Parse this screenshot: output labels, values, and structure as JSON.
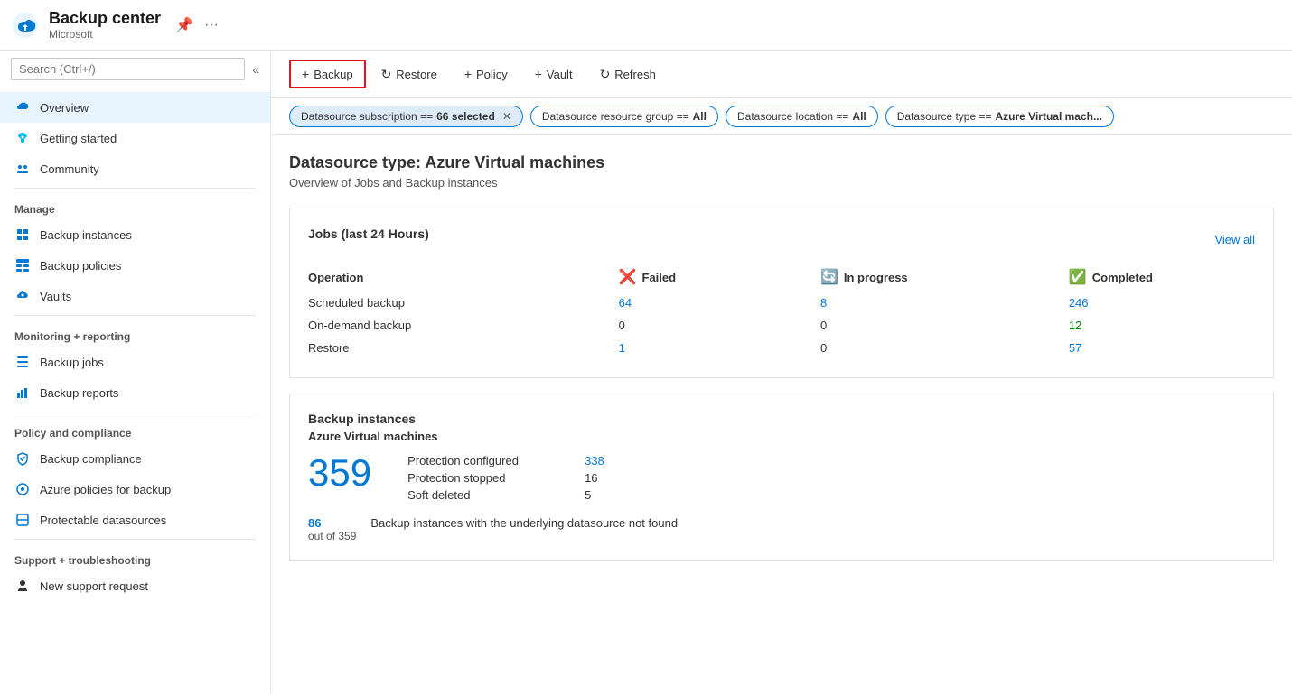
{
  "titleBar": {
    "title": "Backup center",
    "subtitle": "Microsoft"
  },
  "sidebar": {
    "search": {
      "placeholder": "Search (Ctrl+/)"
    },
    "navItems": [
      {
        "id": "overview",
        "label": "Overview",
        "active": true,
        "icon": "cloud"
      },
      {
        "id": "getting-started",
        "label": "Getting started",
        "active": false,
        "icon": "rocket"
      },
      {
        "id": "community",
        "label": "Community",
        "active": false,
        "icon": "users"
      },
      {
        "id": "manage-header",
        "label": "Manage",
        "type": "header"
      },
      {
        "id": "backup-instances",
        "label": "Backup instances",
        "active": false,
        "icon": "grid"
      },
      {
        "id": "backup-policies",
        "label": "Backup policies",
        "active": false,
        "icon": "table"
      },
      {
        "id": "vaults",
        "label": "Vaults",
        "active": false,
        "icon": "cloud-vault"
      },
      {
        "id": "monitoring-header",
        "label": "Monitoring + reporting",
        "type": "header"
      },
      {
        "id": "backup-jobs",
        "label": "Backup jobs",
        "active": false,
        "icon": "list"
      },
      {
        "id": "backup-reports",
        "label": "Backup reports",
        "active": false,
        "icon": "chart"
      },
      {
        "id": "policy-header",
        "label": "Policy and compliance",
        "type": "header"
      },
      {
        "id": "backup-compliance",
        "label": "Backup compliance",
        "active": false,
        "icon": "shield"
      },
      {
        "id": "azure-policies",
        "label": "Azure policies for backup",
        "active": false,
        "icon": "policy"
      },
      {
        "id": "protectable-datasources",
        "label": "Protectable datasources",
        "active": false,
        "icon": "datasource"
      },
      {
        "id": "support-header",
        "label": "Support + troubleshooting",
        "type": "header"
      },
      {
        "id": "new-support-request",
        "label": "New support request",
        "active": false,
        "icon": "person"
      }
    ]
  },
  "toolbar": {
    "buttons": [
      {
        "id": "backup",
        "label": "Backup",
        "icon": "+",
        "primary": true
      },
      {
        "id": "restore",
        "label": "Restore",
        "icon": "↻"
      },
      {
        "id": "policy",
        "label": "Policy",
        "icon": "+"
      },
      {
        "id": "vault",
        "label": "Vault",
        "icon": "+"
      },
      {
        "id": "refresh",
        "label": "Refresh",
        "icon": "↻"
      }
    ]
  },
  "filters": [
    {
      "id": "subscription",
      "label": "Datasource subscription == ",
      "bold": "66 selected",
      "active": true
    },
    {
      "id": "resource-group",
      "label": "Datasource resource group == ",
      "bold": "All",
      "active": false
    },
    {
      "id": "location",
      "label": "Datasource location == ",
      "bold": "All",
      "active": false
    },
    {
      "id": "datasource-type",
      "label": "Datasource type == ",
      "bold": "Azure Virtual mach...",
      "active": false
    }
  ],
  "page": {
    "title": "Datasource type: Azure Virtual machines",
    "subtitle": "Overview of Jobs and Backup instances"
  },
  "jobsCard": {
    "title": "Jobs (last 24 Hours)",
    "viewAll": "View all",
    "columns": {
      "operation": "Operation",
      "failed": "Failed",
      "inProgress": "In progress",
      "completed": "Completed"
    },
    "rows": [
      {
        "operation": "Scheduled backup",
        "failed": "64",
        "inProgress": "8",
        "completed": "246",
        "failedLink": true,
        "inProgressLink": true,
        "completedLink": true
      },
      {
        "operation": "On-demand backup",
        "failed": "0",
        "inProgress": "0",
        "completed": "12",
        "failedLink": false,
        "inProgressLink": false,
        "completedLink": true
      },
      {
        "operation": "Restore",
        "failed": "1",
        "inProgress": "0",
        "completed": "57",
        "failedLink": true,
        "inProgressLink": false,
        "completedLink": true
      }
    ]
  },
  "backupInstancesCard": {
    "sectionTitle": "Backup instances",
    "machineTitle": "Azure Virtual machines",
    "totalCount": "359",
    "details": [
      {
        "label": "Protection configured",
        "value": "338",
        "link": true
      },
      {
        "label": "Protection stopped",
        "value": "16",
        "link": false
      },
      {
        "label": "Soft deleted",
        "value": "5",
        "link": false
      }
    ],
    "footerCount": "86",
    "footerSub": "out of 359",
    "footerDesc": "Backup instances with the underlying datasource not found"
  }
}
